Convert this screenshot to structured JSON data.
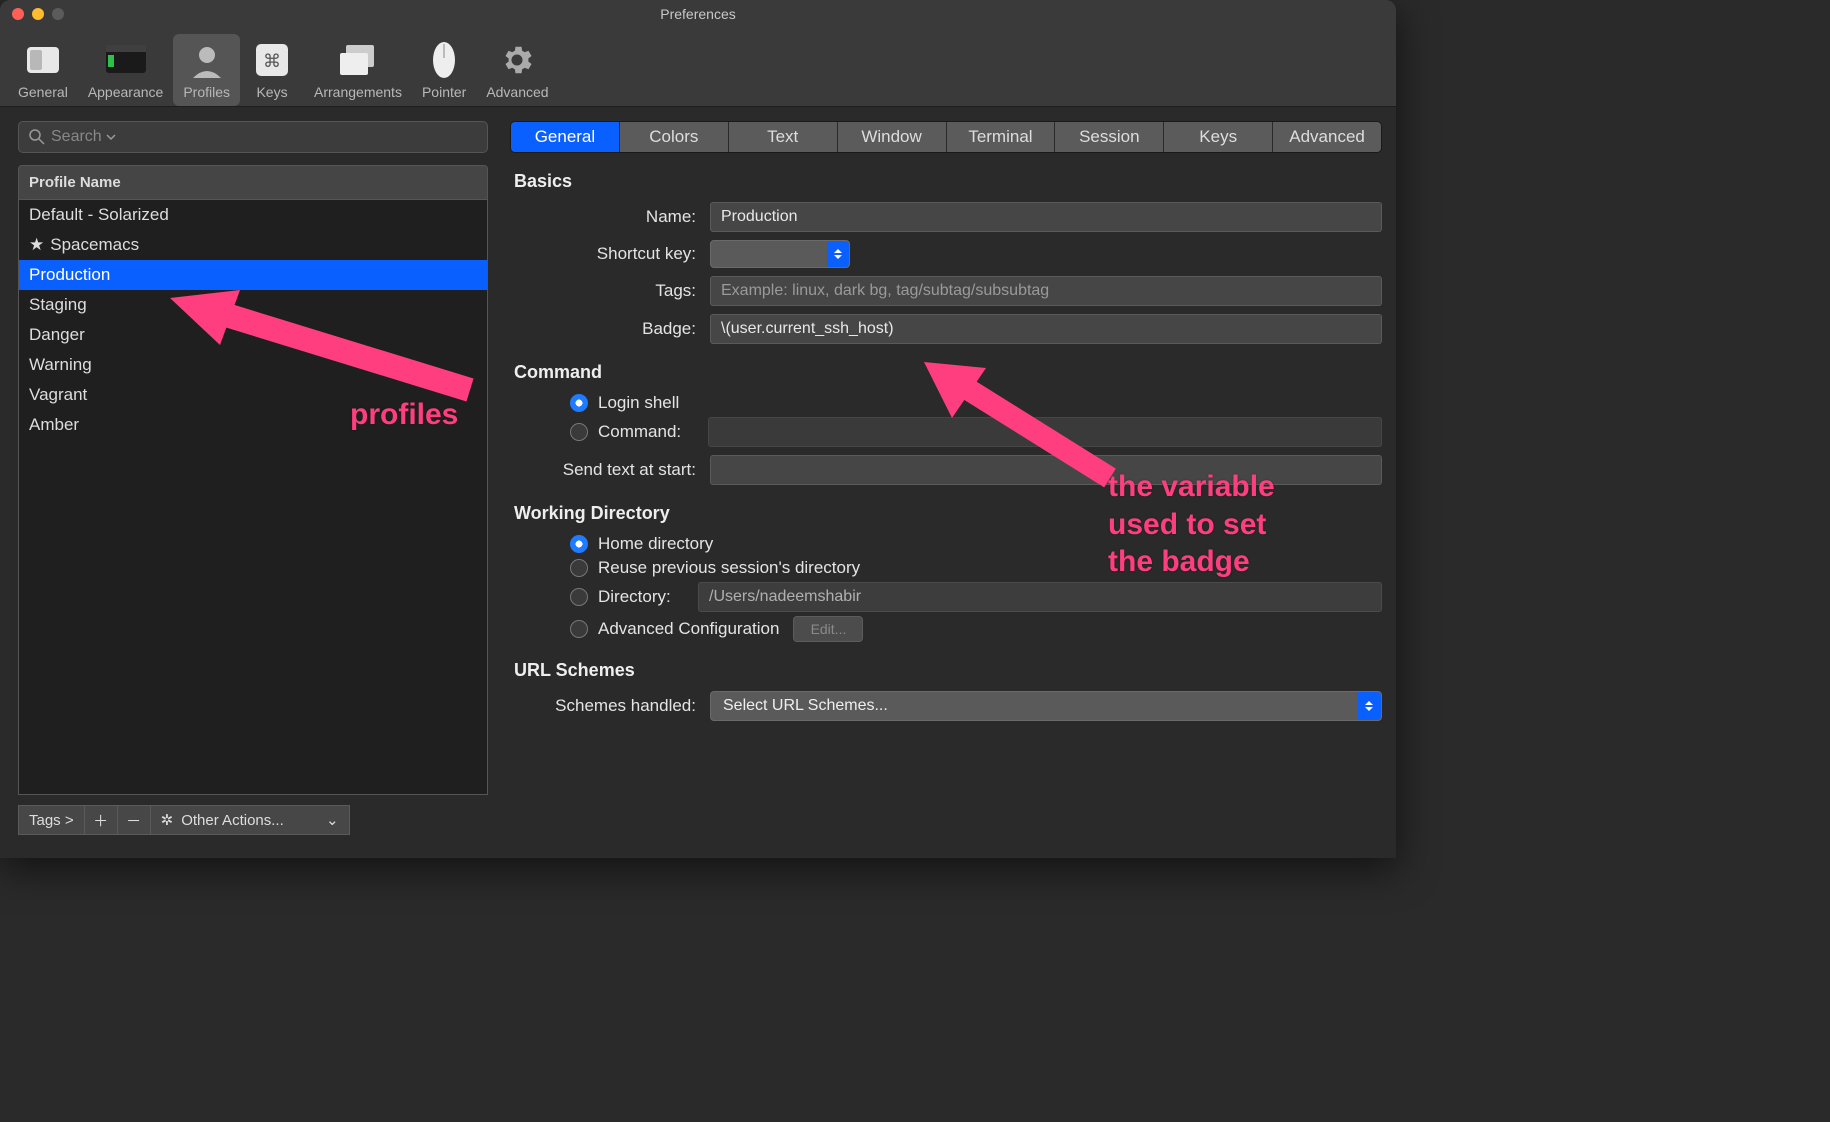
{
  "window": {
    "title": "Preferences"
  },
  "toolbar": {
    "items": [
      {
        "label": "General"
      },
      {
        "label": "Appearance"
      },
      {
        "label": "Profiles"
      },
      {
        "label": "Keys"
      },
      {
        "label": "Arrangements"
      },
      {
        "label": "Pointer"
      },
      {
        "label": "Advanced"
      }
    ]
  },
  "sidebar": {
    "search_placeholder": "Search",
    "header": "Profile Name",
    "profiles": [
      {
        "name": "Default - Solarized",
        "starred": false
      },
      {
        "name": "Spacemacs",
        "starred": true
      },
      {
        "name": "Production",
        "starred": false
      },
      {
        "name": "Staging",
        "starred": false
      },
      {
        "name": "Danger",
        "starred": false
      },
      {
        "name": "Warning",
        "starred": false
      },
      {
        "name": "Vagrant",
        "starred": false
      },
      {
        "name": "Amber",
        "starred": false
      }
    ],
    "selected_index": 2,
    "bottom": {
      "tags_label": "Tags >",
      "other_actions": "Other Actions..."
    }
  },
  "tabs": {
    "items": [
      "General",
      "Colors",
      "Text",
      "Window",
      "Terminal",
      "Session",
      "Keys",
      "Advanced"
    ],
    "selected_index": 0
  },
  "sections": {
    "basics_title": "Basics",
    "command_title": "Command",
    "working_dir_title": "Working Directory",
    "url_schemes_title": "URL Schemes"
  },
  "form": {
    "name_label": "Name:",
    "name_value": "Production",
    "shortcut_label": "Shortcut key:",
    "tags_label": "Tags:",
    "tags_placeholder": "Example: linux, dark bg, tag/subtag/subsubtag",
    "badge_label": "Badge:",
    "badge_value": "\\(user.current_ssh_host)",
    "login_shell_label": "Login shell",
    "command_label": "Command:",
    "send_text_label": "Send text at start:",
    "home_dir_label": "Home directory",
    "reuse_dir_label": "Reuse previous session's directory",
    "directory_label": "Directory:",
    "directory_value": "/Users/nadeemshabir",
    "advanced_config_label": "Advanced Configuration",
    "edit_label": "Edit...",
    "schemes_label": "Schemes handled:",
    "schemes_value": "Select URL Schemes..."
  },
  "annotations": {
    "profiles": "profiles",
    "badge": "the variable used to set the badge"
  }
}
